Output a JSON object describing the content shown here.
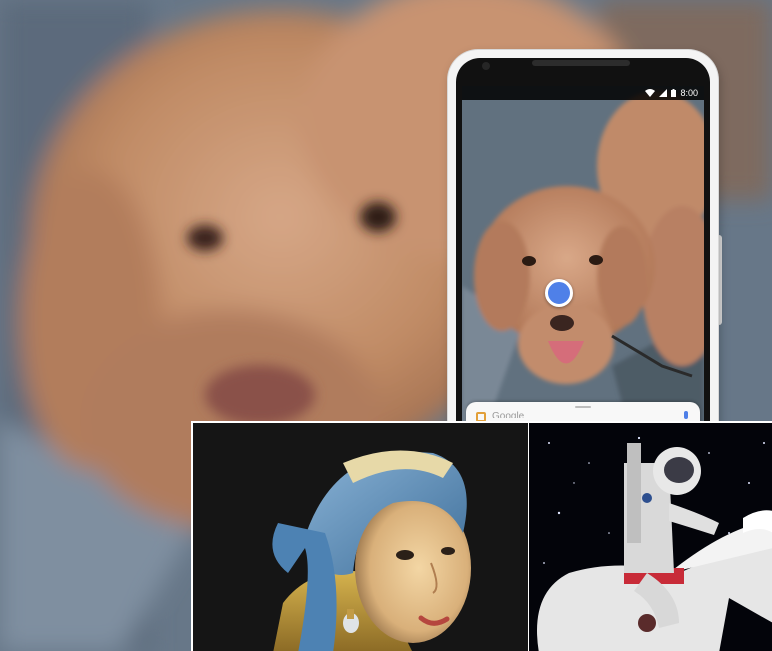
{
  "status_bar": {
    "time": "8:00",
    "icons": [
      "wifi-icon",
      "signal-icon",
      "battery-icon"
    ]
  },
  "lens": {
    "search_placeholder": "Google",
    "accent_color": "#4f80e8",
    "mic_icon": "mic-icon"
  },
  "photos": {
    "background": "dog",
    "phone_screen": "dog",
    "left_panel": "portrait-painting",
    "right_panel": "astronaut-on-horse"
  },
  "colors": {
    "phone_frame": "#f4f4f4",
    "fur": "#c08b65",
    "headscarf": "#6e9ec8",
    "horse": "#e8e8e8"
  }
}
